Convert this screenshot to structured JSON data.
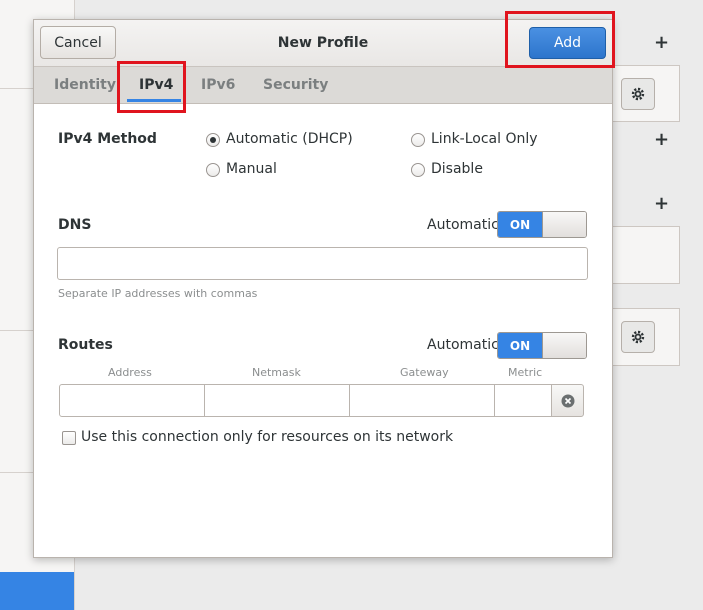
{
  "dialog": {
    "title": "New Profile",
    "cancel_label": "Cancel",
    "add_label": "Add"
  },
  "tabs": [
    {
      "label": "Identity",
      "active": false
    },
    {
      "label": "IPv4",
      "active": true
    },
    {
      "label": "IPv6",
      "active": false
    },
    {
      "label": "Security",
      "active": false
    }
  ],
  "ipv4_method": {
    "label": "IPv4 Method",
    "options": [
      {
        "label": "Automatic (DHCP)",
        "selected": true
      },
      {
        "label": "Link-Local Only",
        "selected": false
      },
      {
        "label": "Manual",
        "selected": false
      },
      {
        "label": "Disable",
        "selected": false
      }
    ]
  },
  "dns": {
    "label": "DNS",
    "automatic_label": "Automatic",
    "switch_label": "ON",
    "value": "",
    "hint": "Separate IP addresses with commas"
  },
  "routes": {
    "label": "Routes",
    "automatic_label": "Automatic",
    "switch_label": "ON",
    "columns": [
      "Address",
      "Netmask",
      "Gateway",
      "Metric"
    ]
  },
  "only_local": {
    "label": "Use this connection only for resources on its network",
    "checked": false
  },
  "background": {
    "plus_glyph": "+"
  },
  "colors": {
    "accent": "#3584e4",
    "highlight": "#e0141e"
  }
}
